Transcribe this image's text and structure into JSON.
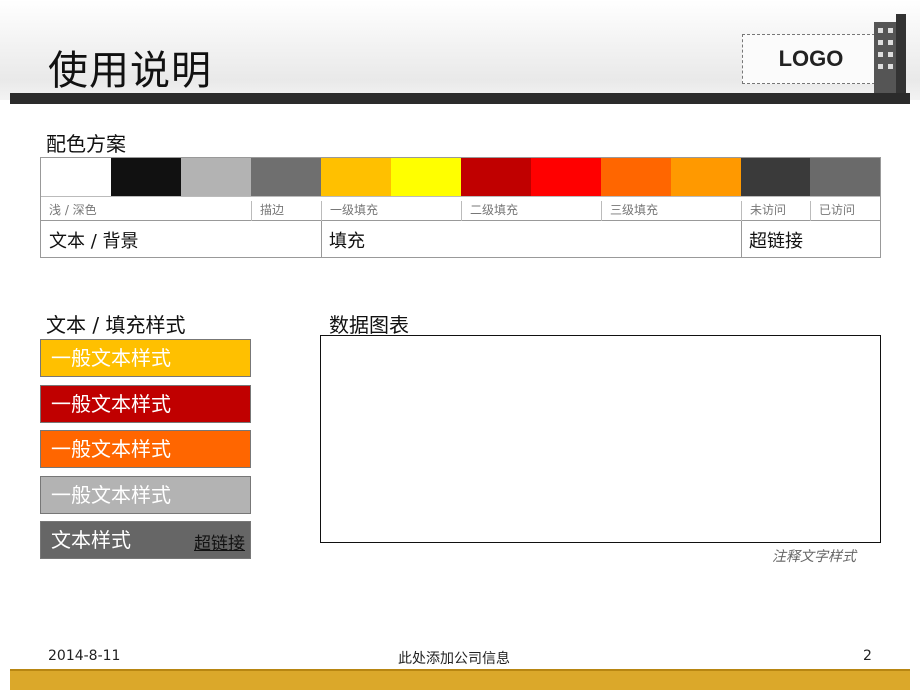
{
  "header": {
    "title": "使用说明",
    "logo": "LOGO"
  },
  "palette": {
    "heading": "配色方案",
    "colors": [
      "#ffffff",
      "#111111",
      "#b3b3b3",
      "#6f6f6f",
      "#ffc000",
      "#ffff00",
      "#c00000",
      "#ff0000",
      "#ff6600",
      "#ff9900",
      "#3a3a3a",
      "#6a6a6a"
    ],
    "small_labels": [
      "浅 / 深色",
      "描边",
      "一级填充",
      "二级填充",
      "三级填充",
      "未访问",
      "已访问"
    ],
    "big_labels": [
      "文本 / 背景",
      "填充",
      "超链接"
    ]
  },
  "text_styles": {
    "heading": "文本 / 填充样式",
    "boxes": [
      {
        "label": "一般文本样式",
        "color": "#ffc000"
      },
      {
        "label": "一般文本样式",
        "color": "#c00000"
      },
      {
        "label": "一般文本样式",
        "color": "#ff6600"
      },
      {
        "label": "一般文本样式",
        "color": "#b3b3b3"
      },
      {
        "label": "文本样式",
        "color": "#666666"
      }
    ],
    "link": "超链接"
  },
  "chart": {
    "heading": "数据图表",
    "annotation": "注释文字样式"
  },
  "footer": {
    "date": "2014-8-11",
    "company": "此处添加公司信息",
    "page": "2"
  }
}
